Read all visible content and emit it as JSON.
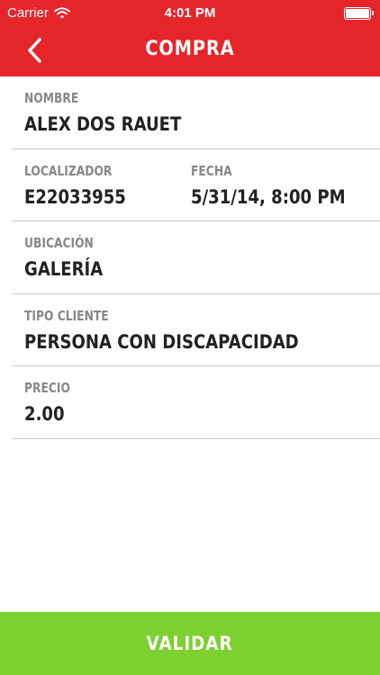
{
  "status_bar": {
    "carrier": "Carrier",
    "time": "4:01 PM",
    "battery_level": 1.0
  },
  "nav": {
    "title": "COMPRA",
    "back_icon": "chevron-left-icon"
  },
  "fields": {
    "nombre": {
      "label": "NOMBRE",
      "value": "ALEX DOS RAUET"
    },
    "localizador": {
      "label": "LOCALIZADOR",
      "value": "E22033955"
    },
    "fecha": {
      "label": "FECHA",
      "value": "5/31/14, 8:00 PM"
    },
    "ubicacion": {
      "label": "UBICACIÓN",
      "value": "GALERÍA"
    },
    "tipo_cliente": {
      "label": "TIPO CLIENTE",
      "value": "PERSONA CON DISCAPACIDAD"
    },
    "precio": {
      "label": "PRECIO",
      "value": "2.00"
    }
  },
  "actions": {
    "validate_label": "VALIDAR"
  },
  "colors": {
    "header": "#e4262b",
    "validate": "#7cd02f",
    "label": "#888888",
    "value": "#222222",
    "divider": "#c8c8cc"
  }
}
